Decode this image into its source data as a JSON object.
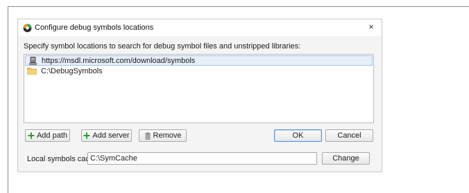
{
  "dialog": {
    "title": "Configure debug symbols locations",
    "close_glyph": "×",
    "instruction": "Specify symbol locations to search for debug symbol files and unstripped libraries:"
  },
  "paths": [
    {
      "icon": "server-icon",
      "text": "https://msdl.microsoft.com/download/symbols",
      "selected": true
    },
    {
      "icon": "folder-icon",
      "text": "C:\\DebugSymbols",
      "selected": false
    }
  ],
  "buttons": {
    "add_path": "Add path",
    "add_server": "Add server",
    "remove": "Remove",
    "ok": "OK",
    "cancel": "Cancel",
    "change": "Change"
  },
  "cache": {
    "label": "Local symbols cache:",
    "value": "C:\\SymCache"
  },
  "colors": {
    "plus_icon": "#2e9e2e",
    "selected_row": "#e6eefa",
    "default_button_border": "#5b8fd6"
  }
}
